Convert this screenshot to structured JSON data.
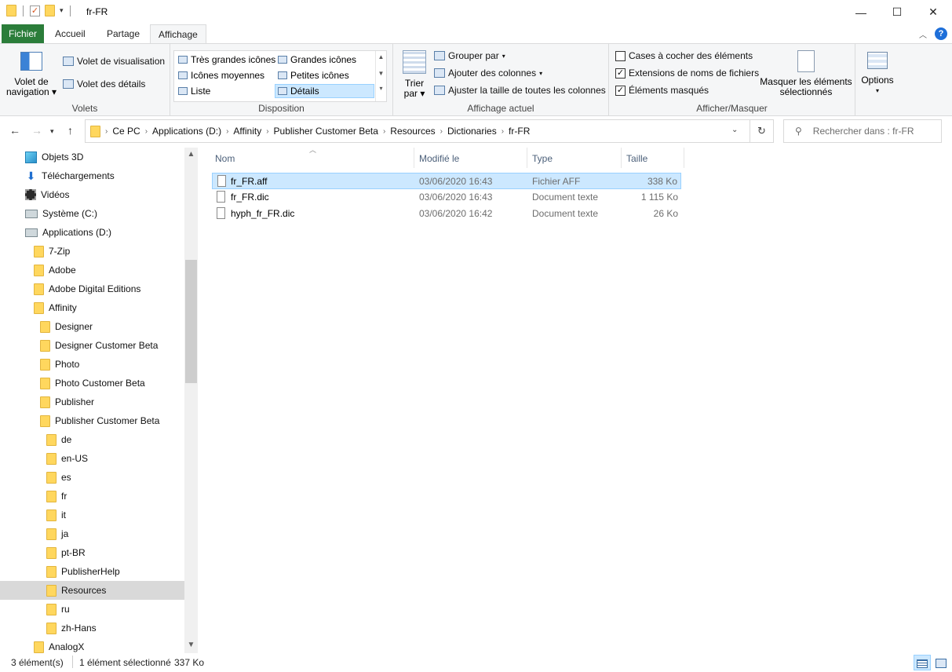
{
  "window": {
    "title": "fr-FR",
    "minimize": "—",
    "maximize": "☐",
    "close": "✕"
  },
  "tabs": [
    "Fichier",
    "Accueil",
    "Partage",
    "Affichage"
  ],
  "ribbon": {
    "panes": {
      "nav_pane_line1": "Volet de",
      "nav_pane_line2": "navigation",
      "preview_pane": "Volet de visualisation",
      "details_pane": "Volet des détails",
      "label": "Volets"
    },
    "layout": {
      "items": [
        "Très grandes icônes",
        "Grandes icônes",
        "Icônes moyennes",
        "Petites icônes",
        "Liste",
        "Détails"
      ],
      "selected": "Détails",
      "label": "Disposition"
    },
    "current_view": {
      "sort_line1": "Trier",
      "sort_line2": "par",
      "group_by": "Grouper par",
      "add_columns": "Ajouter des colonnes",
      "size_columns": "Ajuster la taille de toutes les colonnes",
      "label": "Affichage actuel"
    },
    "show_hide": {
      "item_checkboxes": {
        "label": "Cases à cocher des éléments",
        "checked": false
      },
      "file_extensions": {
        "label": "Extensions de noms de fichiers",
        "checked": true
      },
      "hidden_items": {
        "label": "Éléments masqués",
        "checked": true
      },
      "hide_selected_line1": "Masquer les éléments",
      "hide_selected_line2": "sélectionnés",
      "label": "Afficher/Masquer"
    },
    "options": "Options"
  },
  "breadcrumb": [
    "Ce PC",
    "Applications (D:)",
    "Affinity",
    "Publisher Customer Beta",
    "Resources",
    "Dictionaries",
    "fr-FR"
  ],
  "search": {
    "placeholder": "Rechercher dans : fr-FR"
  },
  "tree": [
    {
      "label": "Objets 3D",
      "icon": "cube-3d-icon",
      "indent": 0
    },
    {
      "label": "Téléchargements",
      "icon": "download-arrow-icon",
      "indent": 0
    },
    {
      "label": "Vidéos",
      "icon": "film-icon",
      "indent": 0
    },
    {
      "label": "Système (C:)",
      "icon": "drive-icon",
      "indent": 0
    },
    {
      "label": "Applications (D:)",
      "icon": "drive-icon",
      "indent": 0
    },
    {
      "label": "7-Zip",
      "icon": "folder-icon",
      "indent": 1
    },
    {
      "label": "Adobe",
      "icon": "folder-icon",
      "indent": 1
    },
    {
      "label": "Adobe Digital Editions",
      "icon": "folder-icon",
      "indent": 1
    },
    {
      "label": "Affinity",
      "icon": "folder-icon",
      "indent": 1
    },
    {
      "label": "Designer",
      "icon": "folder-icon",
      "indent": 2
    },
    {
      "label": "Designer Customer Beta",
      "icon": "folder-icon",
      "indent": 2
    },
    {
      "label": "Photo",
      "icon": "folder-icon",
      "indent": 2
    },
    {
      "label": "Photo Customer Beta",
      "icon": "folder-icon",
      "indent": 2
    },
    {
      "label": "Publisher",
      "icon": "folder-icon",
      "indent": 2
    },
    {
      "label": "Publisher Customer Beta",
      "icon": "folder-icon",
      "indent": 2
    },
    {
      "label": "de",
      "icon": "folder-icon",
      "indent": 3
    },
    {
      "label": "en-US",
      "icon": "folder-icon",
      "indent": 3
    },
    {
      "label": "es",
      "icon": "folder-icon",
      "indent": 3
    },
    {
      "label": "fr",
      "icon": "folder-icon",
      "indent": 3
    },
    {
      "label": "it",
      "icon": "folder-icon",
      "indent": 3
    },
    {
      "label": "ja",
      "icon": "folder-icon",
      "indent": 3
    },
    {
      "label": "pt-BR",
      "icon": "folder-icon",
      "indent": 3
    },
    {
      "label": "PublisherHelp",
      "icon": "folder-icon",
      "indent": 3
    },
    {
      "label": "Resources",
      "icon": "folder-icon",
      "indent": 3,
      "selected": true
    },
    {
      "label": "ru",
      "icon": "folder-icon",
      "indent": 3
    },
    {
      "label": "zh-Hans",
      "icon": "folder-icon",
      "indent": 3
    },
    {
      "label": "AnalogX",
      "icon": "folder-icon",
      "indent": 1
    }
  ],
  "columns": {
    "name": "Nom",
    "modified": "Modifié le",
    "type": "Type",
    "size": "Taille"
  },
  "files": [
    {
      "name": "fr_FR.aff",
      "modified": "03/06/2020 16:43",
      "type": "Fichier AFF",
      "size": "338 Ko",
      "selected": true
    },
    {
      "name": "fr_FR.dic",
      "modified": "03/06/2020 16:43",
      "type": "Document texte",
      "size": "1 115 Ko",
      "selected": false
    },
    {
      "name": "hyph_fr_FR.dic",
      "modified": "03/06/2020 16:42",
      "type": "Document texte",
      "size": "26 Ko",
      "selected": false
    }
  ],
  "status": {
    "count": "3 élément(s)",
    "selection": "1 élément sélectionné",
    "size": "337 Ko"
  },
  "colors": {
    "file_tab": "#2b7d3a",
    "selection": "#cce8ff",
    "selection_border": "#99d1ff",
    "folder": "#ffd75e",
    "help": "#1e6fd9"
  }
}
